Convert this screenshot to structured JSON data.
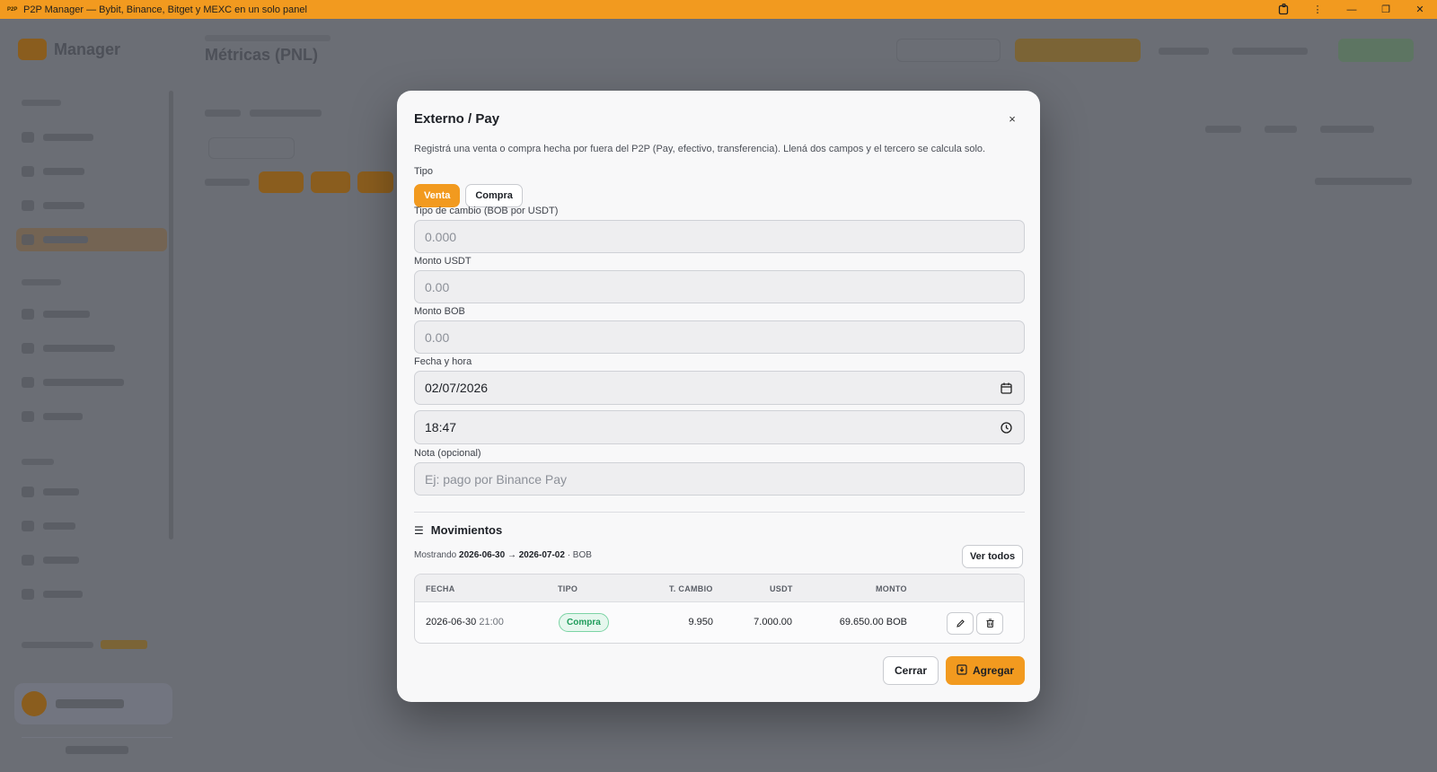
{
  "window": {
    "app_icon": "P2P",
    "title": "P2P Manager — Bybit, Binance, Bitget y MEXC en un solo panel",
    "controls": [
      "extensions-icon",
      "more-icon",
      "minimize-icon",
      "restore-icon",
      "close-icon"
    ]
  },
  "background": {
    "logo": "Manager",
    "page_title": "Métricas (PNL)"
  },
  "modal": {
    "title": "Externo / Pay",
    "close_label": "×",
    "description": "Registrá una venta o compra hecha por fuera del P2P (Pay, efectivo, transferencia). Llená dos campos y el tercero se calcula solo.",
    "tipo_label": "Tipo",
    "tipo_options": [
      "Venta",
      "Compra"
    ],
    "tipo_selected": "Venta",
    "tipo_cambio_label": "Tipo de cambio (BOB por USDT)",
    "tipo_cambio_placeholder": "0.000",
    "monto_usdt_label": "Monto USDT",
    "monto_usdt_placeholder": "0.00",
    "monto_bob_label": "Monto BOB",
    "monto_bob_placeholder": "0.00",
    "fecha_label": "Fecha y hora",
    "fecha_value": "02/07/2026",
    "hora_value": "18:47",
    "nota_label": "Nota (opcional)",
    "nota_placeholder": "Ej: pago por Binance Pay",
    "movimientos": {
      "title": "Movimientos",
      "range_prefix": "Mostrando",
      "range_value": "2026-06-30 → 2026-07-02",
      "range_suffix": "· BOB",
      "ver_todos": "Ver todos",
      "columns": [
        "FECHA",
        "TIPO",
        "T. CAMBIO",
        "USDT",
        "MONTO"
      ],
      "rows": [
        {
          "fecha": "2026-06-30",
          "hora": "21:00",
          "tipo": "Compra",
          "t_cambio": "9.950",
          "usdt": "7.000.00",
          "monto": "69.650.00 BOB"
        }
      ]
    },
    "buttons": {
      "cerrar": "Cerrar",
      "agregar": "Agregar"
    }
  },
  "colors": {
    "accent": "#f29a1f",
    "badge_green": "#1f9c5b",
    "overlay": "#6b6e75"
  }
}
